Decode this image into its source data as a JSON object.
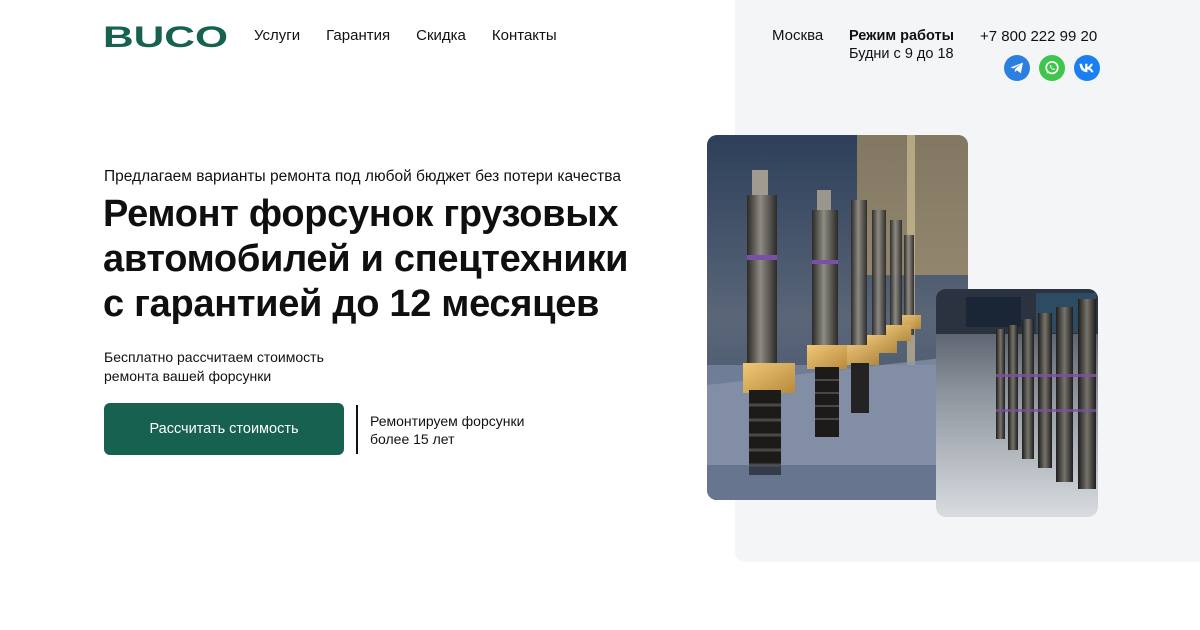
{
  "brand": {
    "logo_text": "BUCO",
    "color": "#16614f"
  },
  "nav": {
    "items": [
      {
        "label": "Услуги"
      },
      {
        "label": "Гарантия"
      },
      {
        "label": "Скидка"
      },
      {
        "label": "Контакты"
      }
    ]
  },
  "contact": {
    "city": "Москва",
    "hours_title": "Режим работы",
    "hours_value": "Будни с 9 до 18",
    "phone": "+7 800 222 99 20",
    "socials": [
      {
        "name": "telegram-icon",
        "color": "#2a7fe1"
      },
      {
        "name": "whatsapp-icon",
        "color": "#3ec54b"
      },
      {
        "name": "vk-icon",
        "color": "#1a7ff0"
      }
    ]
  },
  "hero": {
    "tagline": "Предлагаем варианты ремонта под любой бюджет без потери качества",
    "headline_lines": [
      "Ремонт форсунок грузовых",
      "автомобилей и спецтехники",
      "с гарантией до 12 месяцев"
    ],
    "subtext_lines": [
      "Бесплатно рассчитаем стоимость",
      "ремонта вашей форсунки"
    ],
    "cta_label": "Рассчитать стоимость",
    "experience_lines": [
      "Ремонтируем форсунки",
      "более 15 лет"
    ]
  },
  "colors": {
    "accent": "#16614f",
    "panel": "#f4f5f7",
    "injector_body": "#e0b45a"
  }
}
